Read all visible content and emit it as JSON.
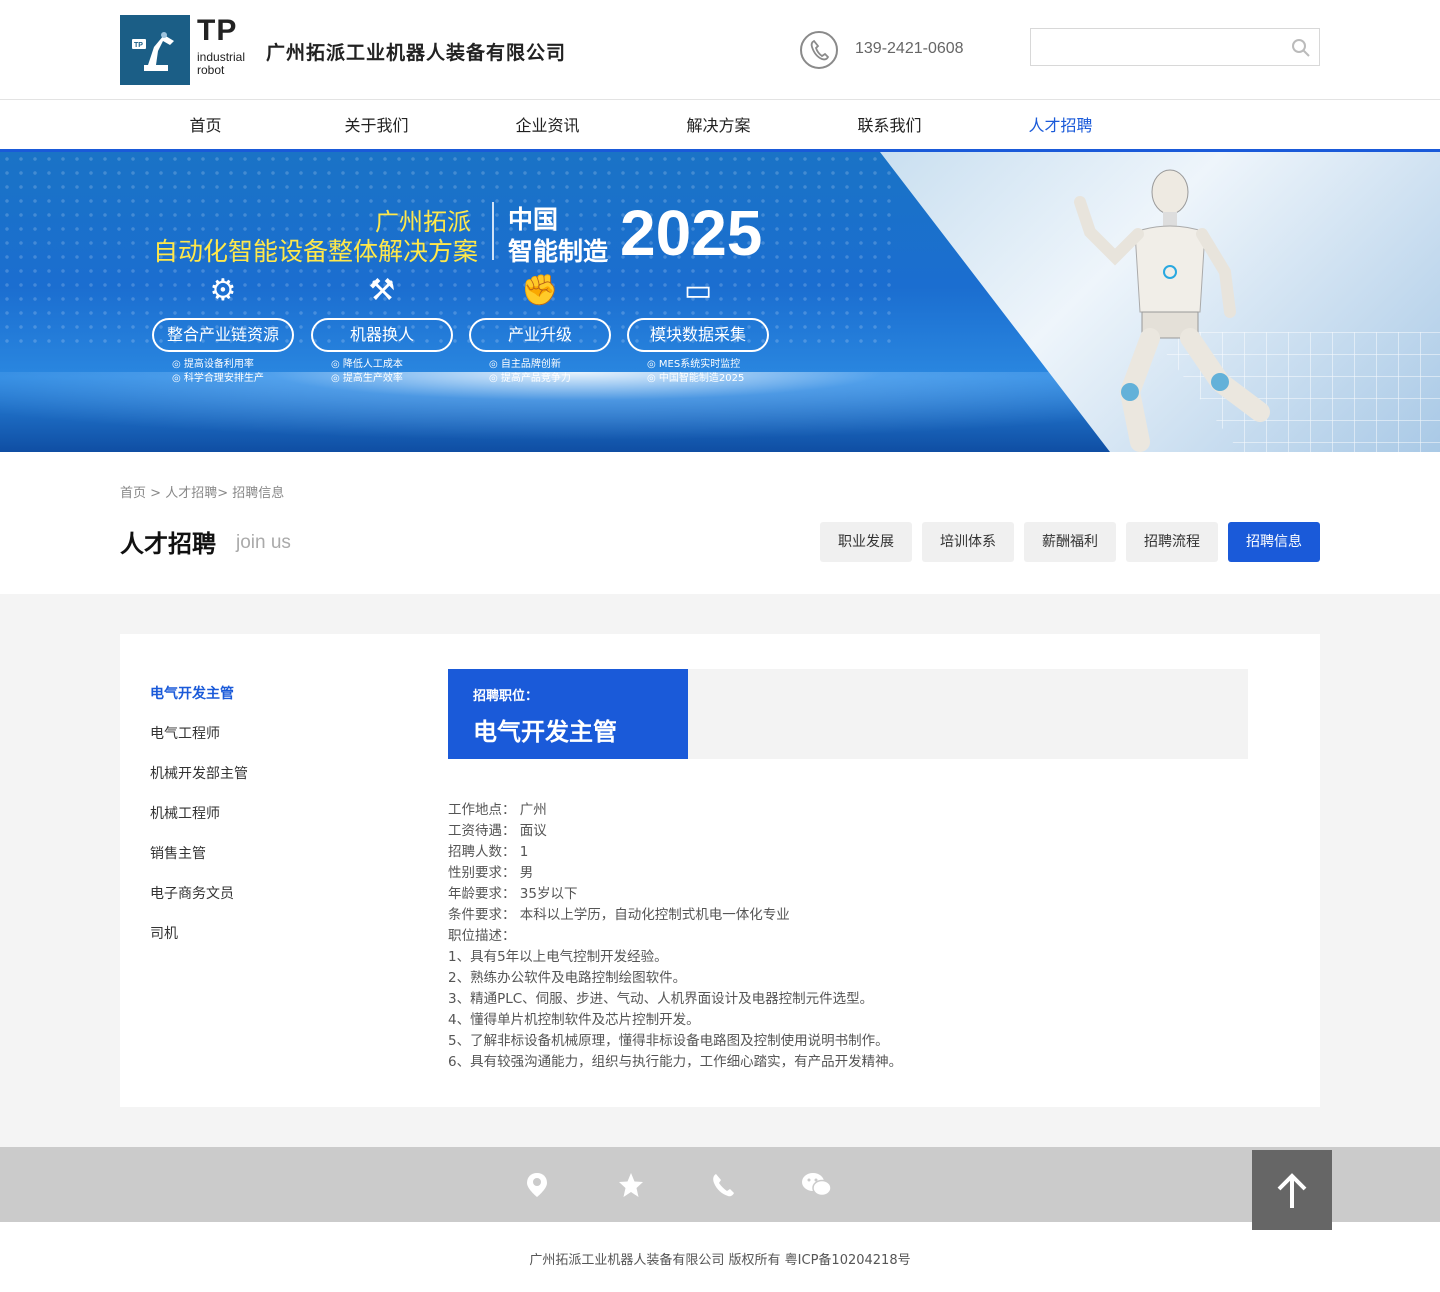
{
  "header": {
    "logo_main": "TP",
    "logo_sub1": "industrial",
    "logo_sub2": "robot",
    "company": "广州拓派工业机器人装备有限公司",
    "phone": "139-2421-0608",
    "search_placeholder": ""
  },
  "nav": {
    "items": [
      "首页",
      "关于我们",
      "企业资讯",
      "解决方案",
      "联系我们",
      "人才招聘"
    ],
    "active": "人才招聘"
  },
  "banner": {
    "line1": "广州拓派",
    "line2": "自动化智能设备整体解决方案",
    "cn1": "中国",
    "cn2": "智能制造",
    "year": "2025",
    "features": [
      {
        "label": "整合产业链资源",
        "sub1": "◎ 提高设备利用率",
        "sub2": "◎ 科学合理安排生产"
      },
      {
        "label": "机器换人",
        "sub1": "◎ 降低人工成本",
        "sub2": "◎ 提高生产效率"
      },
      {
        "label": "产业升级",
        "sub1": "◎ 自主品牌创新",
        "sub2": "◎ 提高产品竞争力"
      },
      {
        "label": "模块数据采集",
        "sub1": "◎ MES系统实时监控",
        "sub2": "◎ 中国智能制造2025"
      }
    ]
  },
  "breadcrumb": {
    "home": "首页",
    "sep1": " > ",
    "section": "人才招聘",
    "sep2": "> ",
    "current": "招聘信息"
  },
  "section": {
    "title": "人才招聘",
    "title_en": "join us",
    "tabs": [
      "职业发展",
      "培训体系",
      "薪酬福利",
      "招聘流程",
      "招聘信息"
    ],
    "active_tab": "招聘信息"
  },
  "sidebar": {
    "items": [
      "电气开发主管",
      "电气工程师",
      "机械开发部主管",
      "机械工程师",
      "销售主管",
      "电子商务文员",
      "司机"
    ],
    "active": "电气开发主管"
  },
  "job": {
    "label": "招聘职位：",
    "name": "电气开发主管",
    "details": [
      "工作地点： 广州",
      "工资待遇： 面议",
      "招聘人数： 1",
      "性别要求： 男",
      "年龄要求： 35岁以下",
      "条件要求： 本科以上学历，自动化控制式机电一体化专业",
      "职位描述：",
      "1、具有5年以上电气控制开发经验。",
      "2、熟练办公软件及电路控制绘图软件。",
      "3、精通PLC、伺服、步进、气动、人机界面设计及电器控制元件选型。",
      "4、懂得单片机控制软件及芯片控制开发。",
      "5、了解非标设备机械原理，懂得非标设备电路图及控制使用说明书制作。",
      "6、具有较强沟通能力，组织与执行能力，工作细心踏实，有产品开发精神。"
    ]
  },
  "footer": {
    "icons": [
      "location-icon",
      "star-icon",
      "phone-icon",
      "wechat-icon"
    ],
    "copyright": "广州拓派工业机器人装备有限公司 版权所有 粤ICP备10204218号"
  },
  "colors": {
    "accent": "#1a5ad9",
    "banner_yellow": "#ffe84a",
    "footer_bar": "#cbcbcb"
  }
}
